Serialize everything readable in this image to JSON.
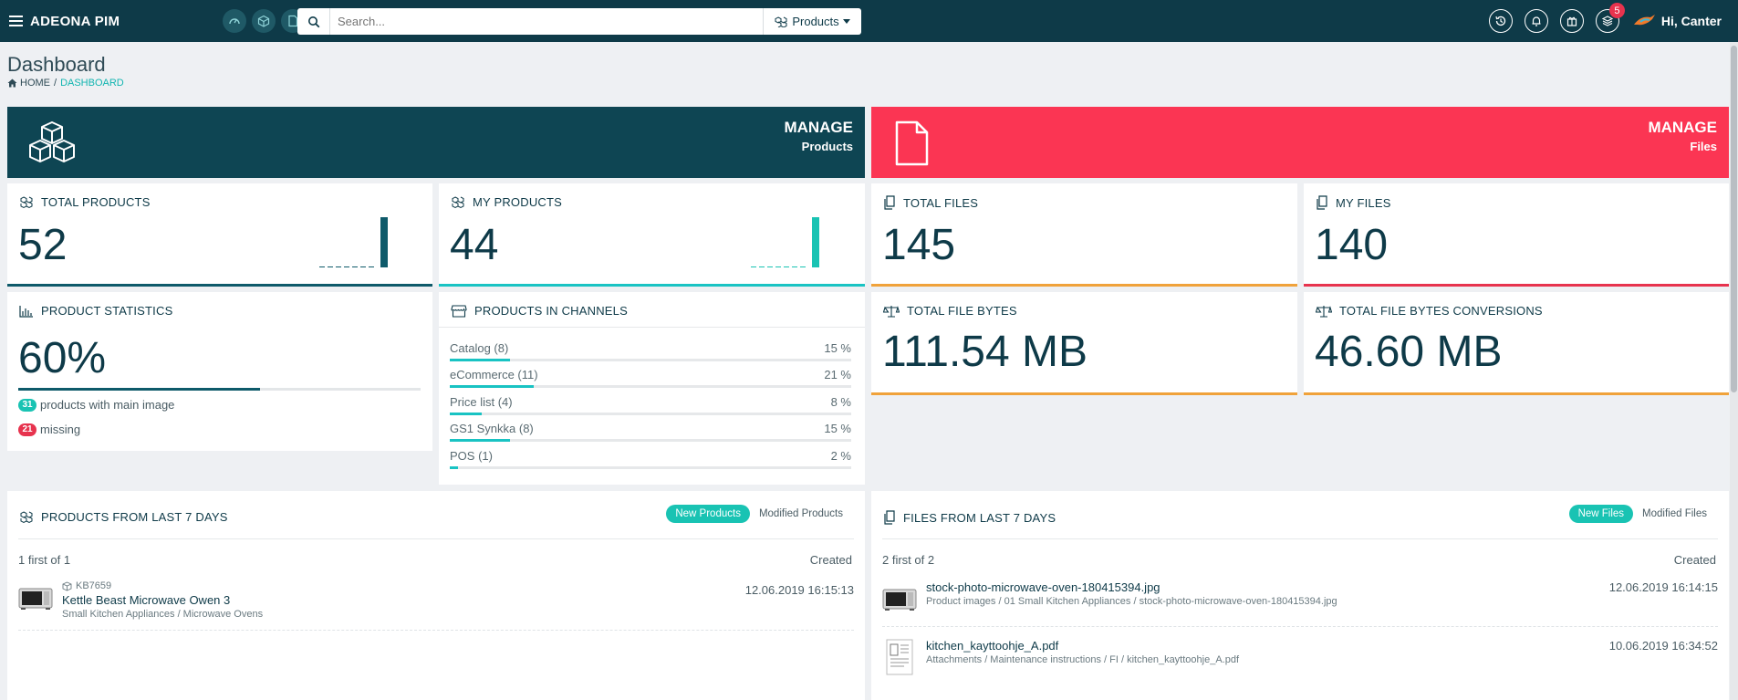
{
  "app": {
    "brand": "ADEONA PIM"
  },
  "search": {
    "placeholder": "Search...",
    "scope_label": "Products"
  },
  "user": {
    "greeting": "Hi, Canter",
    "notifications_count": "5"
  },
  "page": {
    "title": "Dashboard",
    "breadcrumb_home": "HOME",
    "breadcrumb_sep": "/",
    "breadcrumb_current": "DASHBOARD"
  },
  "manage_products": {
    "title": "MANAGE",
    "subtitle": "Products",
    "color": "#0e4553"
  },
  "manage_files": {
    "title": "MANAGE",
    "subtitle": "Files",
    "color": "#fb3553"
  },
  "stats": {
    "total_products": {
      "label": "TOTAL PRODUCTS",
      "value": "52"
    },
    "my_products": {
      "label": "MY PRODUCTS",
      "value": "44"
    },
    "total_files": {
      "label": "TOTAL FILES",
      "value": "145"
    },
    "my_files": {
      "label": "MY FILES",
      "value": "140"
    },
    "total_file_bytes": {
      "label": "TOTAL FILE BYTES",
      "value": "111.54 MB"
    },
    "total_file_bytes_conversions": {
      "label": "TOTAL FILE BYTES CONVERSIONS",
      "value": "46.60 MB"
    }
  },
  "product_statistics": {
    "label": "PRODUCT STATISTICS",
    "value": "60%",
    "progress": 0.6,
    "with_image_count": "31",
    "with_image_text": "products with main image",
    "missing_count": "21",
    "missing_text": "missing"
  },
  "channels": {
    "label": "PRODUCTS IN CHANNELS",
    "items": [
      {
        "name": "Catalog (8)",
        "percent": "15 %",
        "fraction": 0.15
      },
      {
        "name": "eCommerce (11)",
        "percent": "21 %",
        "fraction": 0.21
      },
      {
        "name": "Price list (4)",
        "percent": "8 %",
        "fraction": 0.08
      },
      {
        "name": "GS1 Synkka (8)",
        "percent": "15 %",
        "fraction": 0.15
      },
      {
        "name": "POS (1)",
        "percent": "2 %",
        "fraction": 0.02
      }
    ]
  },
  "products_last7": {
    "title": "PRODUCTS FROM LAST 7 DAYS",
    "tab_new": "New Products",
    "tab_modified": "Modified Products",
    "count_text": "1 first of 1",
    "col_created": "Created",
    "items": [
      {
        "code": "KB7659",
        "name": "Kettle Beast Microwave Owen 3",
        "path": "Small Kitchen Appliances / Microwave Ovens",
        "created": "12.06.2019 16:15:13"
      }
    ]
  },
  "files_last7": {
    "title": "FILES FROM LAST 7 DAYS",
    "tab_new": "New Files",
    "tab_modified": "Modified Files",
    "count_text": "2 first of 2",
    "col_created": "Created",
    "items": [
      {
        "name": "stock-photo-microwave-oven-180415394.jpg",
        "path": "Product images / 01 Small Kitchen Appliances / stock-photo-microwave-oven-180415394.jpg",
        "created": "12.06.2019 16:14:15"
      },
      {
        "name": "kitchen_kayttoohje_A.pdf",
        "path": "Attachments / Maintenance instructions / FI / kitchen_kayttoohje_A.pdf",
        "created": "10.06.2019 16:34:52"
      }
    ]
  },
  "colors": {
    "teal": "#19c3b3",
    "dark": "#0e3a48",
    "orange": "#f0a23a",
    "red": "#e7334e"
  }
}
